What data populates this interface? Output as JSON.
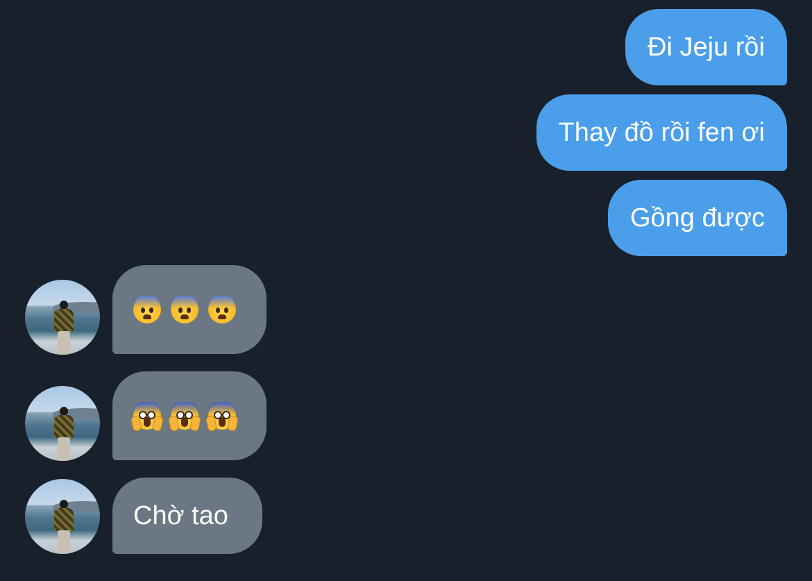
{
  "conversation": {
    "outgoing": [
      {
        "text": "Đi Jeju rồi"
      },
      {
        "text": "Thay đồ rồi fen ơi"
      },
      {
        "text": "Gồng được"
      }
    ],
    "incoming": [
      {
        "emojis": [
          "anxious-face-emoji",
          "anxious-face-emoji",
          "anxious-face-emoji"
        ]
      },
      {
        "emojis": [
          "screaming-face-emoji",
          "screaming-face-emoji",
          "screaming-face-emoji"
        ]
      },
      {
        "text": "Chờ tao"
      }
    ]
  },
  "colors": {
    "background": "#18202b",
    "outgoing_bubble": "#4b9ee9",
    "incoming_bubble": "#6b7783",
    "text": "#ffffff"
  }
}
